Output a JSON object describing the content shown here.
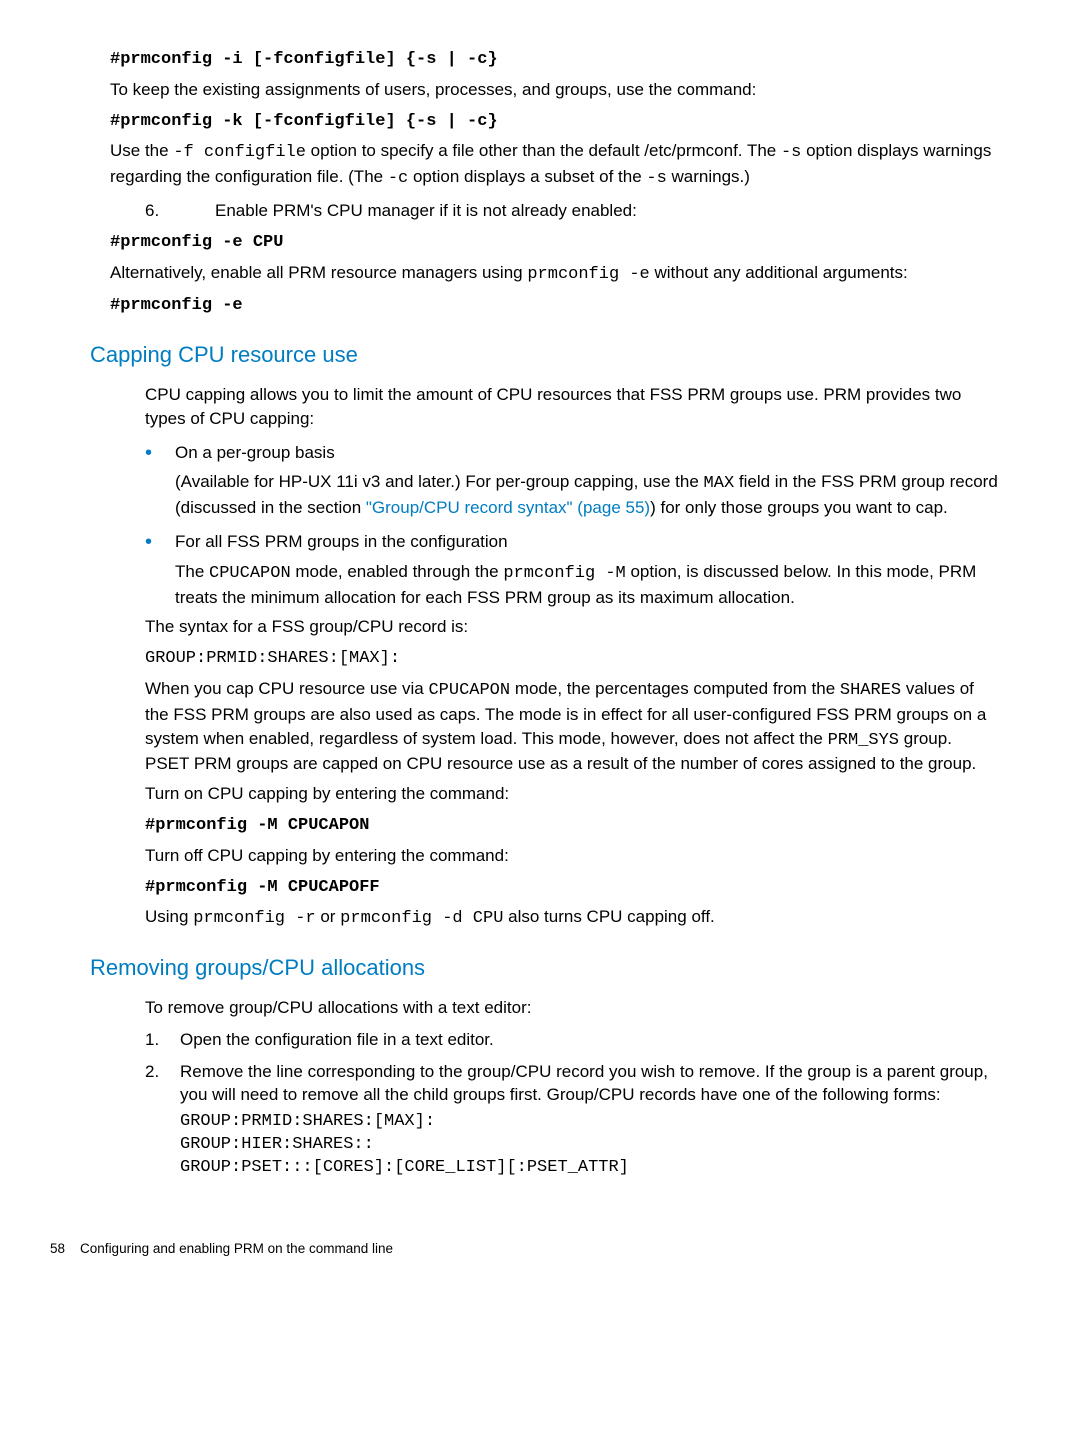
{
  "top": {
    "cmd1": "#prmconfig -i [-fconfigfile] {-s | -c}",
    "para1": "To keep the existing assignments of users, processes, and groups, use the command:",
    "cmd2": "#prmconfig -k [-fconfigfile] {-s | -c}",
    "para2a": "Use the ",
    "para2b": "-f configfile",
    "para2c": " option to specify a file other than the default /etc/prmconf. The ",
    "para2d": "-s",
    "para2e": " option displays warnings regarding the configuration file. (The ",
    "para2f": "-c",
    "para2g": " option displays a subset of the ",
    "para2h": "-s",
    "para2i": " warnings.)"
  },
  "step6": {
    "num": "6.",
    "text": "Enable PRM's CPU manager if it is not already enabled:",
    "cmd1": "#prmconfig -e CPU",
    "para1a": "Alternatively, enable all PRM resource managers using ",
    "para1b": "prmconfig -e",
    "para1c": " without any additional arguments:",
    "cmd2": "#prmconfig -e"
  },
  "sec1": {
    "title": "Capping CPU resource use",
    "intro": "CPU capping allows you to limit the amount of CPU resources that FSS PRM groups use. PRM provides two types of CPU capping:",
    "b1": "On a per-group basis",
    "b1p_a": "(Available for HP-UX 11i v3 and later.) For per-group capping, use the ",
    "b1p_b": "MAX",
    "b1p_c": " field in the FSS PRM group record (discussed in the section ",
    "b1p_link": "\"Group/CPU record syntax\" (page 55)",
    "b1p_d": ") for only those groups you want to cap.",
    "b2": "For all FSS PRM groups in the configuration",
    "b2p_a": "The ",
    "b2p_b": "CPUCAPON",
    "b2p_c": " mode, enabled through the ",
    "b2p_d": "prmconfig -M",
    "b2p_e": " option, is discussed below. In this mode, PRM treats the minimum allocation for each FSS PRM group as its maximum allocation.",
    "syn_label": "The syntax for a FSS group/CPU record is:",
    "syn_code": "GROUP:PRMID:SHARES:[MAX]:",
    "p_a": "When you cap CPU resource use via ",
    "p_b": "CPUCAPON",
    "p_c": " mode, the percentages computed from the ",
    "p_d": "SHARES",
    "p_e": " values of the FSS PRM groups are also used as caps. The mode is in effect for all user-configured FSS PRM groups on a system when enabled, regardless of system load. This mode, however, does not affect the ",
    "p_f": "PRM_SYS",
    "p_g": " group. PSET PRM groups are capped on CPU resource use as a result of the number of cores assigned to the group.",
    "on_label": "Turn on CPU capping by entering the command:",
    "on_cmd": "#prmconfig -M CPUCAPON",
    "off_label": "Turn off CPU capping by entering the command:",
    "off_cmd": "#prmconfig -M CPUCAPOFF",
    "use_a": "Using ",
    "use_b": "prmconfig -r",
    "use_c": " or ",
    "use_d": "prmconfig -d CPU",
    "use_e": " also turns CPU capping off."
  },
  "sec2": {
    "title": "Removing groups/CPU allocations",
    "intro": "To remove group/CPU allocations with a text editor:",
    "s1n": "1.",
    "s1": "Open the configuration file in a text editor.",
    "s2n": "2.",
    "s2": "Remove the line corresponding to the group/CPU record you wish to remove. If the group is a parent group, you will need to remove all the child groups first. Group/CPU records have one of the following forms:",
    "code": "GROUP:PRMID:SHARES:[MAX]:\nGROUP:HIER:SHARES::\nGROUP:PSET:::[CORES]:[CORE_LIST][:PSET_ATTR]"
  },
  "footer": {
    "page": "58",
    "label": "Configuring and enabling PRM on the command line"
  }
}
